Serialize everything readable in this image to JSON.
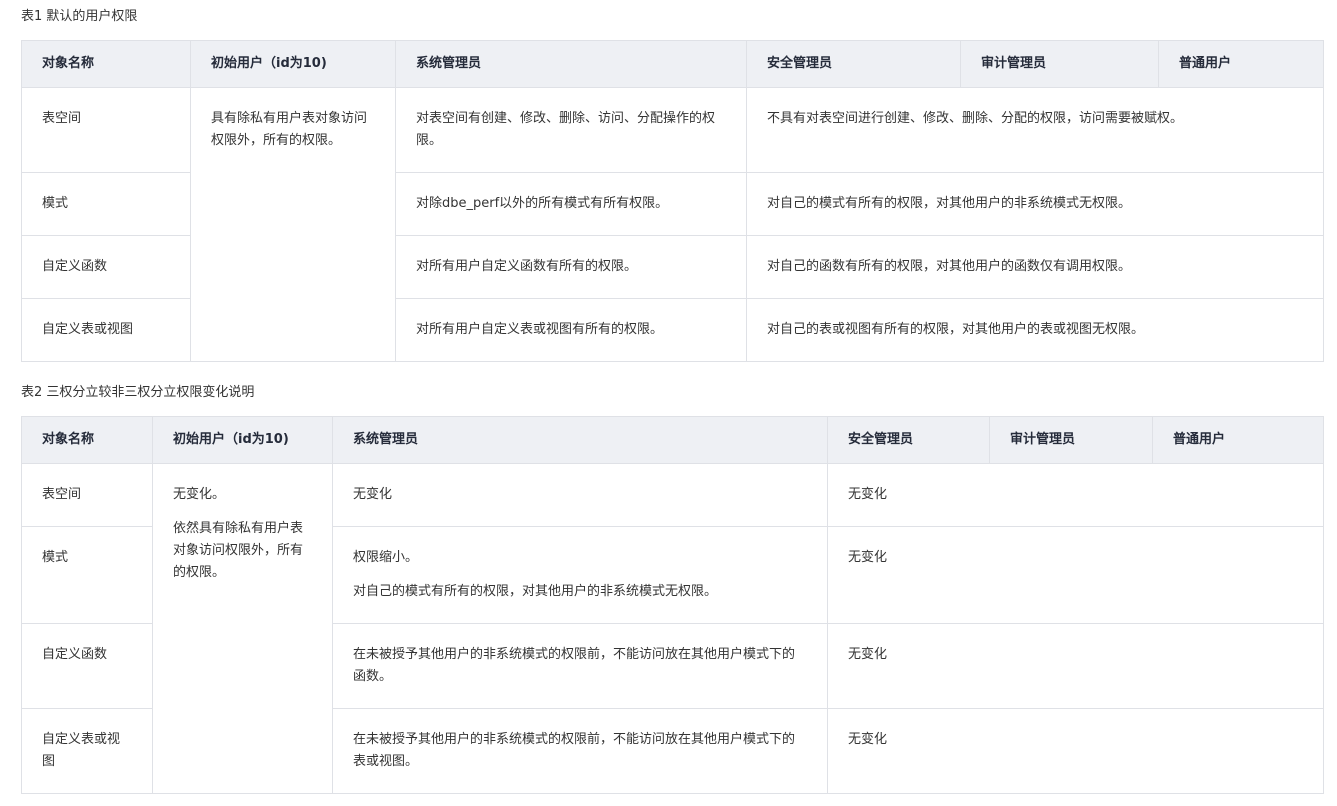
{
  "table1": {
    "caption": "表1 默认的用户权限",
    "headers": [
      "对象名称",
      "初始用户（id为10)",
      "系统管理员",
      "安全管理员",
      "审计管理员",
      "普通用户"
    ],
    "initial_user_text": "具有除私有用户表对象访问权限外，所有的权限。",
    "rows": [
      {
        "object": "表空间",
        "sysadmin": "对表空间有创建、修改、删除、访问、分配操作的权限。",
        "others": "不具有对表空间进行创建、修改、删除、分配的权限，访问需要被赋权。"
      },
      {
        "object": "模式",
        "sysadmin": "对除dbe_perf以外的所有模式有所有权限。",
        "others": "对自己的模式有所有的权限，对其他用户的非系统模式无权限。"
      },
      {
        "object": "自定义函数",
        "sysadmin": "对所有用户自定义函数有所有的权限。",
        "others": "对自己的函数有所有的权限，对其他用户的函数仅有调用权限。"
      },
      {
        "object": "自定义表或视图",
        "sysadmin": "对所有用户自定义表或视图有所有的权限。",
        "others": "对自己的表或视图有所有的权限，对其他用户的表或视图无权限。"
      }
    ]
  },
  "table2": {
    "caption": "表2 三权分立较非三权分立权限变化说明",
    "headers": [
      "对象名称",
      "初始用户（id为10)",
      "系统管理员",
      "安全管理员",
      "审计管理员",
      "普通用户"
    ],
    "initial_user_text_1": "无变化。",
    "initial_user_text_2": "依然具有除私有用户表对象访问权限外，所有的权限。",
    "rows": [
      {
        "object": "表空间",
        "sysadmin": "无变化",
        "sysadmin_2": "",
        "others": "无变化"
      },
      {
        "object": "模式",
        "sysadmin": "权限缩小。",
        "sysadmin_2": "对自己的模式有所有的权限，对其他用户的非系统模式无权限。",
        "others": "无变化"
      },
      {
        "object": "自定义函数",
        "sysadmin": "在未被授予其他用户的非系统模式的权限前，不能访问放在其他用户模式下的函数。",
        "sysadmin_2": "",
        "others": "无变化"
      },
      {
        "object": "自定义表或视图",
        "sysadmin": "在未被授予其他用户的非系统模式的权限前，不能访问放在其他用户模式下的表或视图。",
        "sysadmin_2": "",
        "others": "无变化"
      }
    ]
  }
}
